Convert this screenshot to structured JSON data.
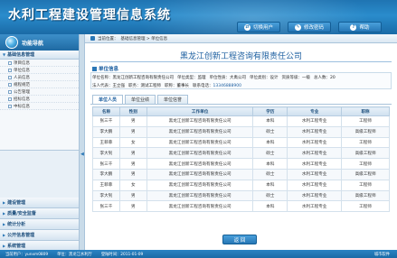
{
  "header": {
    "title": "水利工程建设管理信息系统",
    "buttons": [
      {
        "label": "切换用户",
        "icon": "user-switch-icon"
      },
      {
        "label": "修改密码",
        "icon": "key-icon"
      },
      {
        "label": "帮助",
        "icon": "help-icon"
      }
    ]
  },
  "sidebar": {
    "title": "功能导航",
    "section_basic": "基础信息管理",
    "items": [
      "项目信息",
      "单位信息",
      "人员信息",
      "规程规范",
      "公告管理",
      "招标信息",
      "中标信息"
    ],
    "sections": [
      "建设管理",
      "质量/安全监督",
      "统计分析",
      "公开信息管理",
      "系统管理"
    ]
  },
  "breadcrumb": {
    "prefix": "当前位置：",
    "path": "基础信息管理 > 单位信息"
  },
  "company": {
    "name": "黑龙江创新工程咨询有限责任公司",
    "info_title": "单位信息",
    "row1": [
      {
        "k": "单位名称：",
        "v": "黑龙江创新工程咨询有限责任公司"
      },
      {
        "k": "单位类型：",
        "v": "监理"
      },
      {
        "k": "单位性质：",
        "v": "大禹公司"
      },
      {
        "k": "单位类别：",
        "v": "设计"
      },
      {
        "k": "资质等级：",
        "v": "一级"
      },
      {
        "k": "总人数：",
        "v": "20"
      }
    ],
    "row2": [
      {
        "k": "法人代表：",
        "v": "王立强"
      },
      {
        "k": "职务：",
        "v": "测试工程师"
      },
      {
        "k": "职称：",
        "v": "董事长"
      },
      {
        "k": "联系电话：",
        "v": "13346888900"
      }
    ]
  },
  "tabs": [
    "单位人员",
    "单位业绩",
    "单位信誉"
  ],
  "table": {
    "headers": [
      "名称",
      "性别",
      "工作单位",
      "学历",
      "专业",
      "职称"
    ],
    "rows": [
      [
        "张三千",
        "男",
        "黑龙江创新工程咨询有限责任公司",
        "本科",
        "水利工程专业",
        "工程师"
      ],
      [
        "李大鹏",
        "男",
        "黑龙江创新工程咨询有限责任公司",
        "硕士",
        "水利工程专业",
        "高级工程师"
      ],
      [
        "王菲菲",
        "女",
        "黑龙江创新工程咨询有限责任公司",
        "本科",
        "水利工程专业",
        "工程师"
      ],
      [
        "李大钊",
        "男",
        "黑龙江创新工程咨询有限责任公司",
        "硕士",
        "水利工程专业",
        "高级工程师"
      ],
      [
        "张三千",
        "男",
        "黑龙江创新工程咨询有限责任公司",
        "本科",
        "水利工程专业",
        "工程师"
      ],
      [
        "李大鹏",
        "男",
        "黑龙江创新工程咨询有限责任公司",
        "硕士",
        "水利工程专业",
        "高级工程师"
      ],
      [
        "王菲菲",
        "女",
        "黑龙江创新工程咨询有限责任公司",
        "本科",
        "水利工程专业",
        "工程师"
      ],
      [
        "李大钊",
        "男",
        "黑龙江创新工程咨询有限责任公司",
        "硕士",
        "水利工程专业",
        "高级工程师"
      ],
      [
        "张三千",
        "男",
        "黑龙江创新工程咨询有限责任公司",
        "本科",
        "水利工程专业",
        "工程师"
      ]
    ]
  },
  "back_button": "返 回",
  "status": {
    "user": "当前用户：yunxm0809",
    "unit": "单位：黑龙江水利厅",
    "date": "登陆时间：2011-01-09",
    "company": "城市软件"
  }
}
